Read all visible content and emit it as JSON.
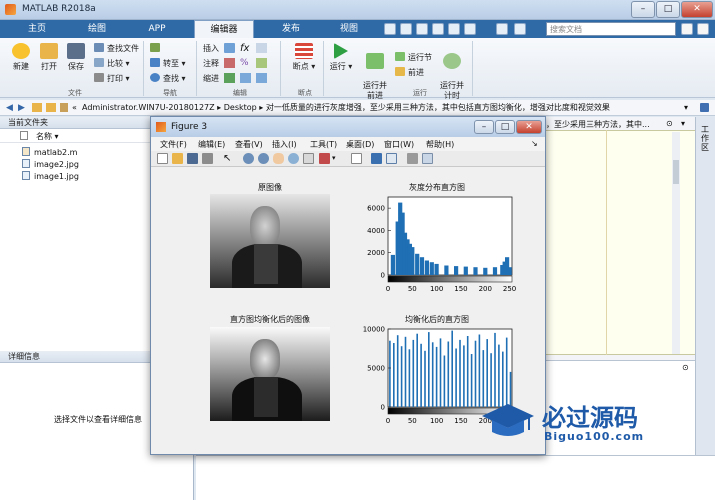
{
  "window": {
    "title": "MATLAB R2018a"
  },
  "tabs": [
    "主页",
    "绘图",
    "APP",
    "编辑器",
    "发布",
    "视图"
  ],
  "active_tab": "编辑器",
  "search": {
    "placeholder": "搜索文档"
  },
  "toolstrip": {
    "file": {
      "new": "新建",
      "open": "打开",
      "save": "保存",
      "find_files": "查找文件",
      "compare": "比较",
      "print": "打印",
      "group": "文件"
    },
    "nav": {
      "goto": "转至",
      "find": "查找",
      "group": "导航"
    },
    "edit": {
      "insert": "插入",
      "comment": "注释",
      "indent": "缩进",
      "group": "编辑"
    },
    "breakpoints": {
      "label": "断点",
      "group": "断点"
    },
    "run": {
      "run": "运行",
      "run_advance": "运行并\n前进",
      "run_section": "运行节",
      "advance": "前进",
      "run_time": "运行并\n计时",
      "group": "运行"
    }
  },
  "address": {
    "path_prefix": "«",
    "segments": [
      "Administrator.WIN7U-20180127Z",
      "Desktop",
      "对一低质量的进行灰度增强，至少采用三种方法，其中包括直方图均衡化，增强对比度和视觉效果"
    ]
  },
  "left_panel": {
    "header": "当前文件夹",
    "col_name": "名称",
    "files": [
      "matlab2.m",
      "image2.jpg",
      "image1.jpg"
    ],
    "details_header": "详细信息",
    "details_hint": "选择文件以查看详细信息"
  },
  "right_snippet": "，至少采用三种方法，其中...",
  "right_vtab": "工作区",
  "figure": {
    "title": "Figure 3",
    "menu": [
      "文件(F)",
      "编辑(E)",
      "查看(V)",
      "插入(I)",
      "工具(T)",
      "桌面(D)",
      "窗口(W)",
      "帮助(H)"
    ],
    "subplots": {
      "orig_title": "原图像",
      "hist_title": "灰度分布直方图",
      "eq_title": "直方图均衡化后的图像",
      "eqhist_title": "均衡化后的直方图"
    }
  },
  "chart_data": [
    {
      "type": "bar",
      "title": "灰度分布直方图",
      "xlim": [
        0,
        255
      ],
      "ylim": [
        0,
        7000
      ],
      "xticks": [
        0,
        50,
        100,
        150,
        200,
        250
      ],
      "yticks": [
        0,
        2000,
        4000,
        6000
      ],
      "x": [
        0,
        10,
        20,
        25,
        30,
        35,
        40,
        45,
        50,
        60,
        70,
        80,
        90,
        100,
        120,
        140,
        160,
        180,
        200,
        220,
        235,
        240,
        245,
        250,
        255
      ],
      "values": [
        0,
        1800,
        4800,
        6500,
        5600,
        3800,
        3200,
        2800,
        2500,
        1900,
        1600,
        1300,
        1150,
        1000,
        850,
        800,
        750,
        700,
        650,
        700,
        900,
        1200,
        1600,
        700,
        0
      ],
      "color": "#1f6fb5"
    },
    {
      "type": "bar",
      "title": "均衡化后的直方图",
      "xlim": [
        0,
        255
      ],
      "ylim": [
        0,
        10000
      ],
      "xticks": [
        0,
        50,
        100,
        150,
        200,
        250
      ],
      "yticks": [
        0,
        5000,
        10000
      ],
      "x": [
        4,
        12,
        20,
        28,
        36,
        44,
        52,
        60,
        68,
        76,
        84,
        92,
        100,
        108,
        116,
        124,
        132,
        140,
        148,
        156,
        164,
        172,
        180,
        188,
        196,
        204,
        212,
        220,
        228,
        236,
        244,
        252
      ],
      "values": [
        8500,
        8200,
        9200,
        7800,
        9000,
        7400,
        8600,
        9400,
        8100,
        7200,
        9600,
        8300,
        7700,
        8800,
        6600,
        8400,
        9800,
        7500,
        8600,
        7900,
        9100,
        6800,
        8500,
        9300,
        7300,
        8700,
        6900,
        9500,
        8000,
        7100,
        8900,
        4500
      ],
      "color": "#1f6fb5"
    }
  ],
  "watermark": {
    "text": "必过源码",
    "sub": "Biguo100.com"
  }
}
